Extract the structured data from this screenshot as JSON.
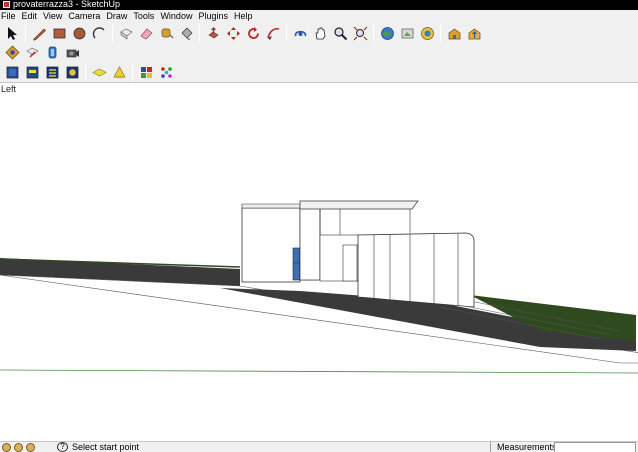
{
  "window": {
    "title": "provaterrazza3 - SketchUp"
  },
  "menu": [
    "File",
    "Edit",
    "View",
    "Camera",
    "Draw",
    "Tools",
    "Window",
    "Plugins",
    "Help"
  ],
  "viewport": {
    "view_name": "Left"
  },
  "status": {
    "hint": "Select start point",
    "measurements_label": "Measurements",
    "measurements_value": ""
  },
  "colors": {
    "ground": "#7a7a7a",
    "terrain_dark": "#3a3a3a",
    "terrain_green": "#2f4a1e",
    "horizon": "#4a8a4a",
    "glass": "#3f6fb0"
  }
}
